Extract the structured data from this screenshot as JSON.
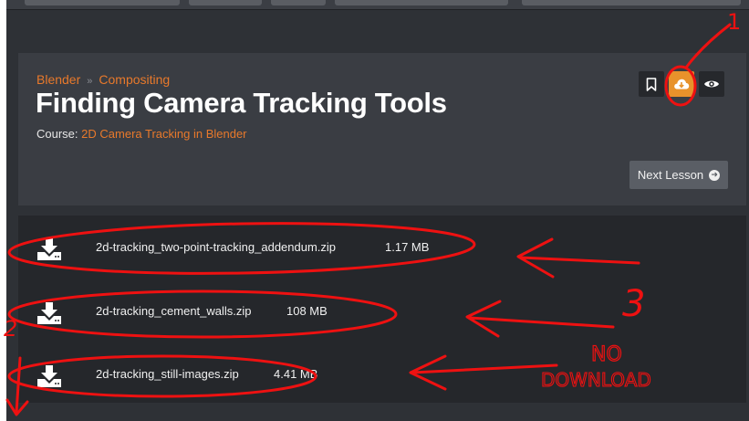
{
  "breadcrumb": {
    "items": [
      "Blender",
      "Compositing"
    ],
    "separator": "»"
  },
  "page_title": "Finding Camera Tracking Tools",
  "course": {
    "prefix": "Course:",
    "name": "2D Camera Tracking in Blender"
  },
  "actions": {
    "bookmark_icon": "bookmark-icon",
    "download_icon": "cloud-download-icon",
    "watch_icon": "eye-icon"
  },
  "next_lesson": {
    "label": "Next Lesson",
    "icon": "arrow-right-circle-icon"
  },
  "files": [
    {
      "name": "2d-tracking_two-point-tracking_addendum.zip",
      "size": "1.17 MB"
    },
    {
      "name": "2d-tracking_cement_walls.zip",
      "size": "108 MB"
    },
    {
      "name": "2d-tracking_still-images.zip",
      "size": "4.41 MB"
    }
  ],
  "annotations": {
    "marker_1": "1",
    "marker_2": "2",
    "marker_3": "3",
    "note_line1": "NO",
    "note_line2": "DOWNLOAD"
  },
  "colors": {
    "accent": "#e8792b",
    "download_button": "#e8922b",
    "annotation": "#ee1111",
    "panel": "#3a3d43",
    "files_panel": "#25272b"
  }
}
